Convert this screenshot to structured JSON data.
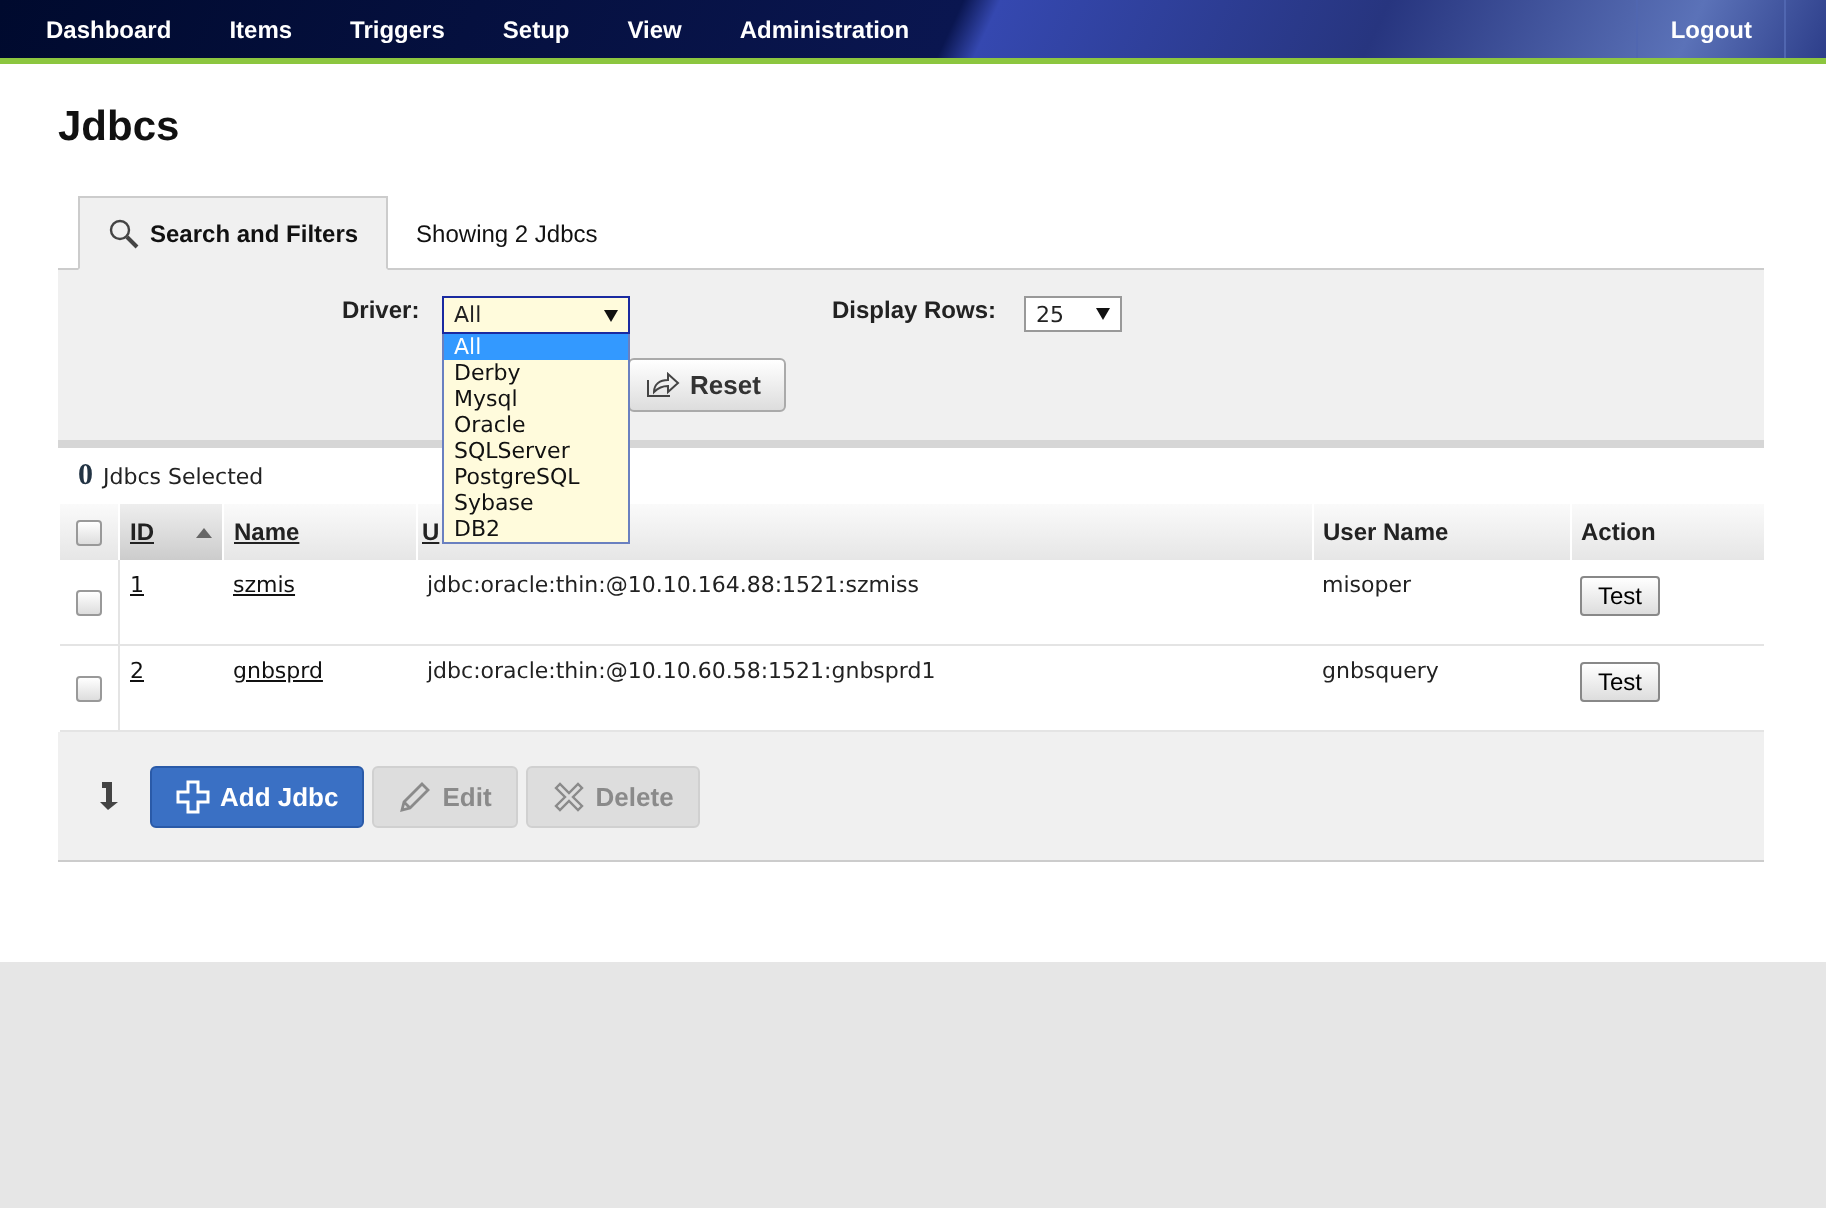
{
  "nav": {
    "items": [
      "Dashboard",
      "Items",
      "Triggers",
      "Setup",
      "View",
      "Administration"
    ],
    "logout": "Logout"
  },
  "title": "Jdbcs",
  "tabs": [
    {
      "label": "Search and Filters",
      "selected": true
    },
    {
      "label": "Showing 2 Jdbcs",
      "selected": false
    }
  ],
  "filters": {
    "driver_label": "Driver:",
    "driver": {
      "value": "All",
      "expanded": true,
      "options": [
        {
          "label": "All",
          "selected": true
        },
        {
          "label": "Derby",
          "selected": false
        },
        {
          "label": "Mysql",
          "selected": false
        },
        {
          "label": "Oracle",
          "selected": false
        },
        {
          "label": "SQLServer",
          "selected": false
        },
        {
          "label": "PostgreSQL",
          "selected": false
        },
        {
          "label": "Sybase",
          "selected": false
        },
        {
          "label": "DB2",
          "selected": false
        }
      ]
    },
    "rows_label": "Display Rows:",
    "rows_value": "25",
    "reset": "Reset"
  },
  "selection": {
    "count": "0",
    "label": "Jdbcs Selected"
  },
  "table": {
    "all_checked": false,
    "columns": [
      {
        "label": "ID",
        "sorted": true,
        "link": true
      },
      {
        "label": "Name",
        "sorted": false,
        "link": true
      },
      {
        "label": "U",
        "sorted": false,
        "link": true
      },
      {
        "label": "User Name",
        "sorted": false,
        "link": false
      },
      {
        "label": "Action",
        "sorted": false,
        "link": false
      }
    ],
    "rows": [
      {
        "checked": false,
        "id": "1",
        "name": "szmis",
        "url": "jdbc:oracle:thin:@10.10.164.88:1521:szmiss",
        "user": "misoper",
        "action": "Test"
      },
      {
        "checked": false,
        "id": "2",
        "name": "gnbsprd",
        "url": "jdbc:oracle:thin:@10.10.60.58:1521:gnbsprd1",
        "user": "gnbsquery",
        "action": "Test"
      }
    ]
  },
  "actions": [
    {
      "label": "Add Jdbc",
      "kind": "add",
      "disabled": false
    },
    {
      "label": "Edit",
      "kind": "edit",
      "disabled": true
    },
    {
      "label": "Delete",
      "kind": "delete",
      "disabled": true
    }
  ]
}
